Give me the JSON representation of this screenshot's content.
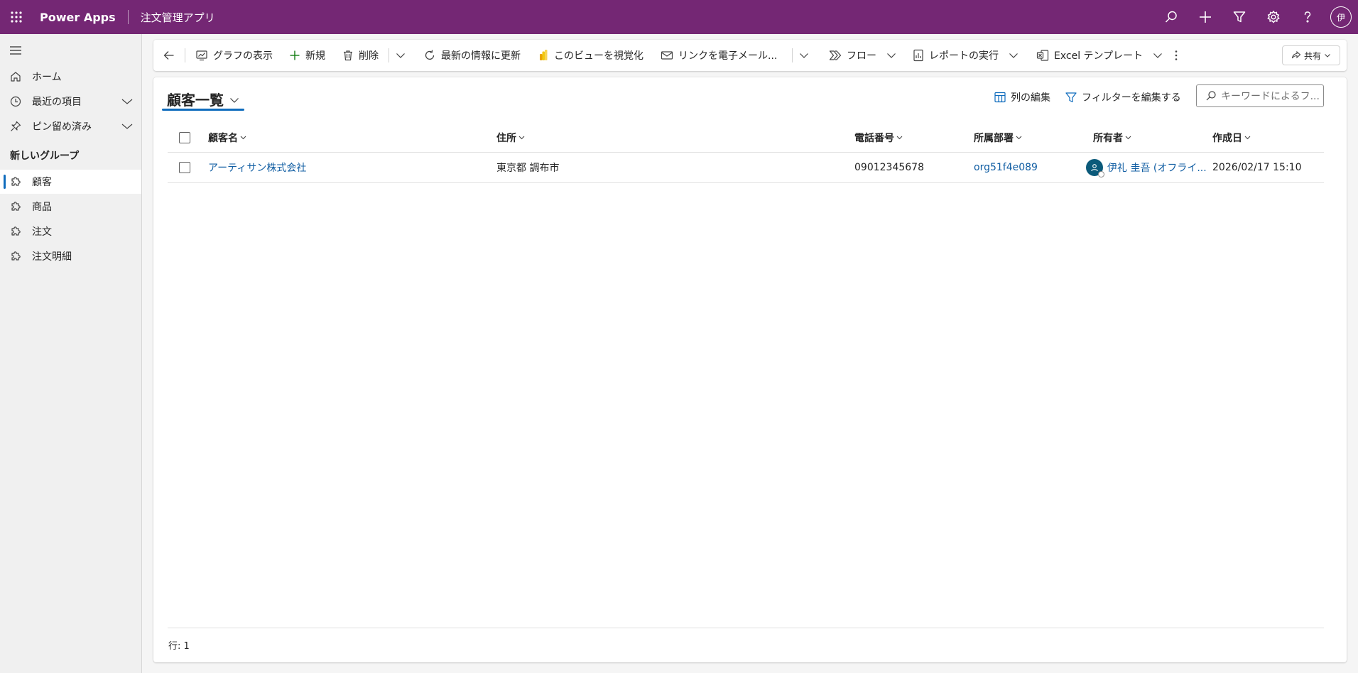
{
  "topbar": {
    "brand": "Power Apps",
    "app_title": "注文管理アプリ",
    "icons": [
      "search-icon",
      "add-icon",
      "filter-icon",
      "settings-icon",
      "help-icon"
    ],
    "user_initial": "伊",
    "background_color": "#742774"
  },
  "sidebar": {
    "items": [
      {
        "label": "ホーム",
        "icon": "home-icon"
      },
      {
        "label": "最近の項目",
        "icon": "clock-icon"
      },
      {
        "label": "ピン留め済み",
        "icon": "pin-icon"
      }
    ],
    "group_title": "新しいグループ",
    "group_items": [
      {
        "label": "顧客",
        "icon": "puzzle-icon",
        "active": true
      },
      {
        "label": "商品",
        "icon": "puzzle-icon",
        "active": false
      },
      {
        "label": "注文",
        "icon": "puzzle-icon",
        "active": false
      },
      {
        "label": "注文明細",
        "icon": "puzzle-icon",
        "active": false
      }
    ]
  },
  "commandbar": {
    "show_chart": "グラフの表示",
    "new": "新規",
    "delete": "削除",
    "refresh": "最新の情報に更新",
    "visualize": "このビューを視覚化",
    "email_link": "リンクを電子メール...",
    "flow": "フロー",
    "run_report": "レポートの実行",
    "excel_templates": "Excel テンプレート",
    "share": "共有"
  },
  "view": {
    "title": "顧客一覧",
    "edit_columns": "列の編集",
    "edit_filters": "フィルターを編集する",
    "search_placeholder": "キーワードによるフ...",
    "accent_color": "#0f6cbd"
  },
  "grid": {
    "columns": [
      "顧客名",
      "住所",
      "電話番号",
      "所属部署",
      "所有者",
      "作成日"
    ],
    "rows": [
      {
        "name": "アーティサン株式会社",
        "address": "東京都 調布市",
        "phone": "09012345678",
        "department": "org51f4e089",
        "owner": "伊礼 圭吾 (オフライ...",
        "created": "2026/02/17 15:10"
      }
    ],
    "row_count": "行: 1"
  }
}
